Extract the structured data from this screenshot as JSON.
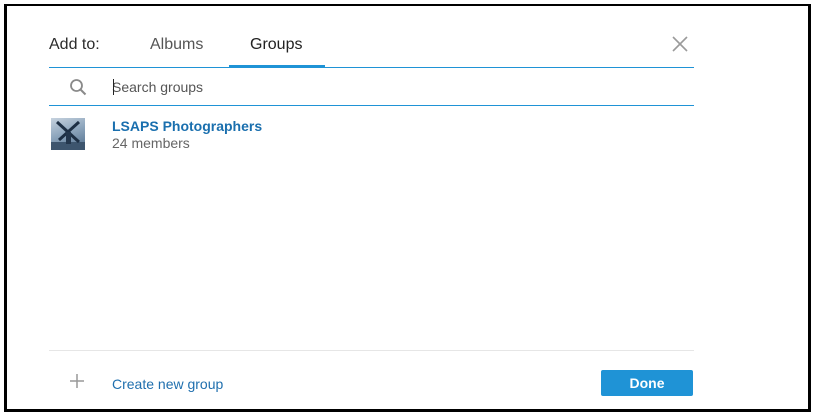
{
  "header": {
    "add_to_label": "Add to:",
    "tabs": [
      {
        "label": "Albums",
        "active": false
      },
      {
        "label": "Groups",
        "active": true
      }
    ]
  },
  "search": {
    "placeholder": "Search groups",
    "value": ""
  },
  "groups": [
    {
      "name": "LSAPS Photographers",
      "members": "24 members"
    }
  ],
  "footer": {
    "create_label": "Create new group",
    "done_label": "Done"
  },
  "colors": {
    "accent": "#1f93d6",
    "link": "#1a6fae"
  },
  "icons": {
    "search": "search-icon",
    "close": "close-icon",
    "add": "plus-icon"
  }
}
